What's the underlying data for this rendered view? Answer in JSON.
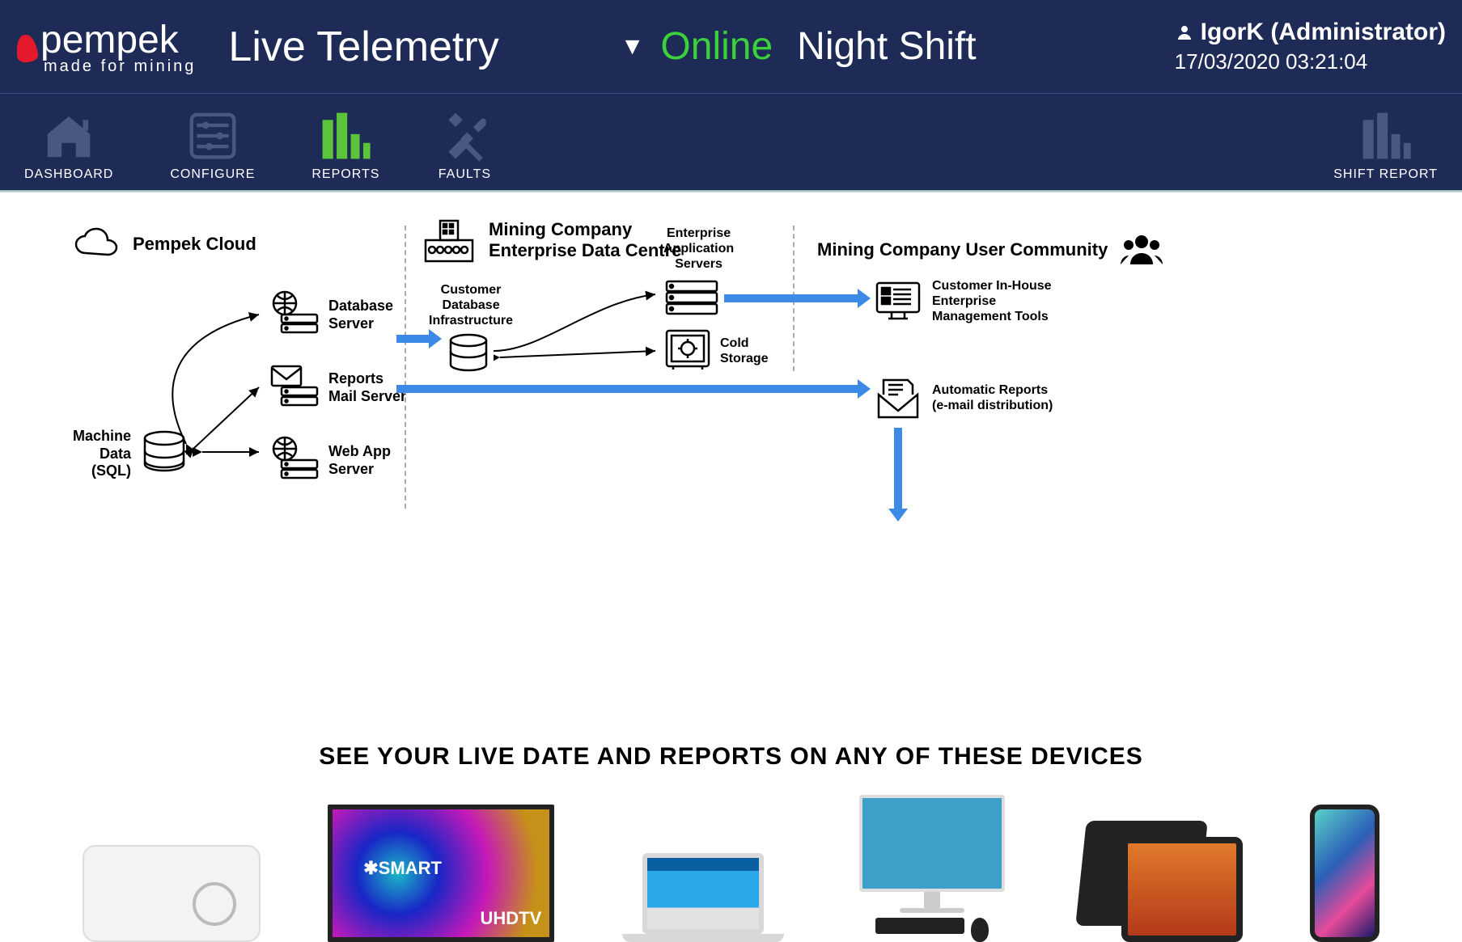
{
  "header": {
    "brand": "pempek",
    "brand_sub": "made for mining",
    "page_title": "Live Telemetry",
    "status_online": "Online",
    "status_shift": "Night Shift",
    "user_label": "IgorK (Administrator)",
    "datetime": "17/03/2020 03:21:04"
  },
  "nav": {
    "dashboard": "DASHBOARD",
    "configure": "CONFIGURE",
    "reports": "REPORTS",
    "faults": "FAULTS",
    "shift_report": "SHIFT REPORT"
  },
  "diagram": {
    "pempek_cloud": "Pempek Cloud",
    "machine_data_a": "Machine",
    "machine_data_b": "Data",
    "machine_data_c": "(SQL)",
    "db_server_a": "Database",
    "db_server_b": "Server",
    "mail_server_a": "Reports",
    "mail_server_b": "Mail Server",
    "web_server_a": "Web App",
    "web_server_b": "Server",
    "edc_a": "Mining Company",
    "edc_b": "Enterprise Data Centre",
    "cdb_a": "Customer",
    "cdb_b": "Database",
    "cdb_c": "Infrastructure",
    "eas_a": "Enterprise",
    "eas_b": "Application",
    "eas_c": "Servers",
    "cold_a": "Cold",
    "cold_b": "Storage",
    "community": "Mining Company User Community",
    "tools_a": "Customer In-House",
    "tools_b": "Enterprise",
    "tools_c": "Management Tools",
    "auto_a": "Automatic Reports",
    "auto_b": "(e-mail distribution)"
  },
  "devices": {
    "heading": "SEE YOUR LIVE DATE AND REPORTS ON ANY OF THESE DEVICES",
    "tv_smart": "✱SMART",
    "tv_uhd": "UHDTV"
  }
}
